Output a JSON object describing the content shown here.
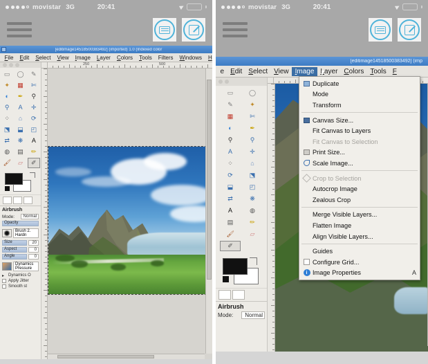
{
  "status_bar": {
    "signal_dots": 5,
    "signal_filled": 4,
    "carrier": "movistar",
    "network": "3G",
    "time": "20:41",
    "location_icon": "location-arrow-icon",
    "battery_icon": "battery-icon",
    "battery_color": "#3ddc52"
  },
  "app_toolbar": {
    "menu_icon": "hamburger-menu-icon",
    "keyboard_button": "keyboard-icon",
    "compose_button": "compose-icon",
    "accent_color": "#4fb3d9"
  },
  "gimp": {
    "title_left": "[editimage14518500383492] (imported) 1.0 (Indexed color",
    "title_right": "[editimage14518500383492] (imp",
    "menu_items": [
      {
        "label": "File",
        "mnemonic": "F"
      },
      {
        "label": "Edit",
        "mnemonic": "E"
      },
      {
        "label": "Select",
        "mnemonic": "S"
      },
      {
        "label": "View",
        "mnemonic": "V"
      },
      {
        "label": "Image",
        "mnemonic": "I"
      },
      {
        "label": "Layer",
        "mnemonic": "L"
      },
      {
        "label": "Colors",
        "mnemonic": "C"
      },
      {
        "label": "Tools",
        "mnemonic": "T"
      },
      {
        "label": "Filters",
        "mnemonic": "R"
      },
      {
        "label": "Windows",
        "mnemonic": "W"
      },
      {
        "label": "Help",
        "mnemonic": "H"
      }
    ],
    "menu_items_right": [
      {
        "label": "e",
        "mnemonic": ""
      },
      {
        "label": "Edit",
        "mnemonic": "E"
      },
      {
        "label": "Select",
        "mnemonic": "S"
      },
      {
        "label": "View",
        "mnemonic": "V"
      },
      {
        "label": "Image",
        "mnemonic": "I"
      },
      {
        "label": "Layer",
        "mnemonic": "L"
      },
      {
        "label": "Colors",
        "mnemonic": "C"
      },
      {
        "label": "Tools",
        "mnemonic": "T"
      },
      {
        "label": "F",
        "mnemonic": "F"
      }
    ],
    "active_menu": "Image",
    "ruler_labels_h": [
      "250",
      "500"
    ],
    "ruler_unit": "px"
  },
  "image_menu": {
    "items": [
      {
        "label": "Duplicate",
        "icon": "duplicate-icon",
        "disabled": false,
        "accel": ""
      },
      {
        "label": "Mode",
        "icon": "",
        "disabled": false,
        "accel": ""
      },
      {
        "label": "Transform",
        "icon": "",
        "disabled": false,
        "accel": ""
      },
      {
        "separator": true
      },
      {
        "label": "Canvas Size...",
        "icon": "canvas-size-icon",
        "disabled": false,
        "accel": ""
      },
      {
        "label": "Fit Canvas to Layers",
        "icon": "",
        "disabled": false,
        "accel": ""
      },
      {
        "label": "Fit Canvas to Selection",
        "icon": "",
        "disabled": true,
        "accel": ""
      },
      {
        "label": "Print Size...",
        "icon": "print-size-icon",
        "disabled": false,
        "accel": ""
      },
      {
        "label": "Scale Image...",
        "icon": "scale-image-icon",
        "disabled": false,
        "accel": ""
      },
      {
        "separator": true
      },
      {
        "label": "Crop to Selection",
        "icon": "crop-icon",
        "disabled": true,
        "accel": ""
      },
      {
        "label": "Autocrop Image",
        "icon": "",
        "disabled": false,
        "accel": ""
      },
      {
        "label": "Zealous Crop",
        "icon": "",
        "disabled": false,
        "accel": ""
      },
      {
        "separator": true
      },
      {
        "label": "Merge Visible Layers...",
        "icon": "",
        "disabled": false,
        "accel": ""
      },
      {
        "label": "Flatten Image",
        "icon": "",
        "disabled": false,
        "accel": ""
      },
      {
        "label": "Align Visible Layers...",
        "icon": "",
        "disabled": false,
        "accel": ""
      },
      {
        "separator": true
      },
      {
        "label": "Guides",
        "icon": "",
        "disabled": false,
        "accel": ""
      },
      {
        "label": "Configure Grid...",
        "icon": "grid-icon",
        "disabled": false,
        "accel": ""
      },
      {
        "label": "Image Properties",
        "icon": "info-icon",
        "disabled": false,
        "accel": "A"
      }
    ]
  },
  "tool_options": {
    "title": "Airbrush",
    "mode_label": "Mode:",
    "mode_value": "Normal",
    "opacity_label": "Opacity",
    "brush_label": "Brush",
    "brush_value": "2. Hardn",
    "size_label": "Size",
    "size_value": "20",
    "aspect_label": "Aspect",
    "aspect_value": "0",
    "angle_label": "Angle",
    "angle_value": "0",
    "dynamics_label": "Dynamics",
    "dynamics_value": "Pressure",
    "dynamics_options_label": "Dynamics O",
    "apply_jitter_label": "Apply Jitter",
    "smooth_label": "Smooth st",
    "foreground_color": "#111111",
    "background_color": "#ffffff"
  },
  "toolbox": {
    "tools": [
      "rect-select-tool",
      "ellipse-select-tool",
      "free-select-tool",
      "fuzzy-select-tool",
      "color-select-tool",
      "scissors-select-tool",
      "foreground-select-tool",
      "paths-tool",
      "color-picker-tool",
      "zoom-tool",
      "measure-tool",
      "move-tool",
      "alignment-tool",
      "crop-tool",
      "rotate-tool",
      "scale-tool",
      "shear-tool",
      "perspective-tool",
      "flip-tool",
      "cage-transform-tool",
      "text-tool",
      "bucket-fill-tool",
      "gradient-tool",
      "pencil-tool",
      "paintbrush-tool",
      "eraser-tool",
      "airbrush-tool"
    ],
    "selected_tool": "airbrush-tool"
  },
  "canvas": {
    "image_alt": "mountain-landscape-photo",
    "sky_color": "#2f76bd",
    "mountain_color": "#6b6b5a",
    "grass_color": "#65a63f",
    "water_color": "#b9d2de"
  }
}
